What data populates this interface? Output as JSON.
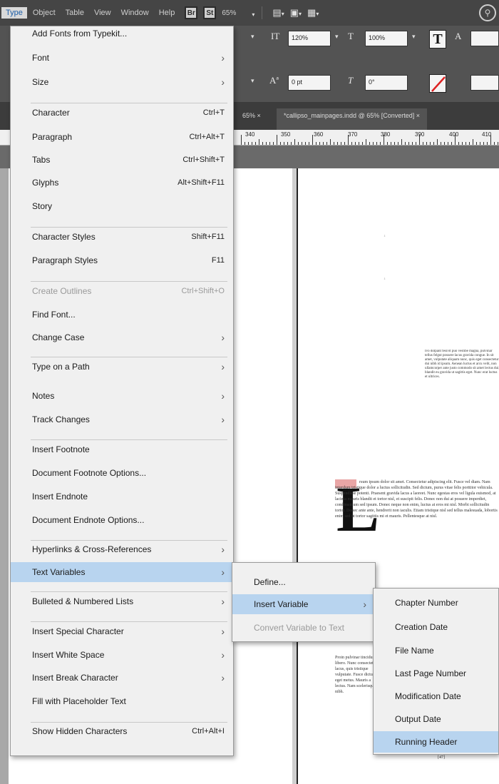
{
  "menubar": {
    "items": [
      "Type",
      "Object",
      "Table",
      "View",
      "Window",
      "Help"
    ],
    "zoom": "65%"
  },
  "control_panel": {
    "font_size_field": "120%",
    "tracking_field": "100%",
    "leading_field": "0 pt",
    "baseline_field": "0°",
    "scale_label": "A"
  },
  "tabs": {
    "inactive": "65% ×",
    "active": "*callipso_mainpages.indd @ 65% [Converted] ×"
  },
  "ruler": {
    "numbers": [
      "340",
      "350",
      "360",
      "370",
      "380",
      "390",
      "400",
      "410"
    ]
  },
  "document": {
    "sidebar_text": "Ivo dolpant fesivit puo vestibe magna, pulvinar tellus felgut posuere lacus gravida congue. In sit amet, vulputate aliquam nunc, quis eget consectetur dui nibh id ipsum. Aenean luctus et arcu velit, non ullamcorper ante justo commodo sit amet lectus dui, blandit eu gravida ut sagittis eget. Nunc erat luctus et ultrices.",
    "body_text": "rsum ipsum dolor sit amet. Consectetur adipiscing elit. Fusce vel diam. Nam interdum tristique dolor a luctus sollicitudin. Sed dictum, purus vitae felis porttitor vehicula. Suspendisse potenti. Praesent gravida lacus a laoreet. Nunc egestas eros vel ligula euismod, at lacinia mauris blandit et tortor nisl, et suscipit felis. Donec non dui at posuere imperdiet, condimentum sed ipsum. Donec neque non enim, luctus at eros mi nisl. Morbi sollicitudin tortor. Donec ante ante, hendrerit non iaculis. Etiam tristique nisl sed tellus malesuada, lobortis enim sed ut tortor sagittis mi et mauris. Pellentesque at nisl.",
    "body_text_2": "Proin pulvinar tincidunt libero. Nunc consectetur lacus, quis tristique vulputate. Fusce dictum eget metus. Mauris a lectus. Nam scelerisque nibh.",
    "dropcap": "L",
    "page_number": "[47]"
  },
  "type_menu": {
    "items": [
      {
        "label": "Add Fonts from Typekit...",
        "shortcut": "",
        "arrow": false,
        "disabled": false
      },
      {
        "label": "Font",
        "shortcut": "",
        "arrow": true,
        "disabled": false
      },
      {
        "label": "Size",
        "shortcut": "",
        "arrow": true,
        "disabled": false
      },
      {
        "label": "Character",
        "shortcut": "Ctrl+T",
        "arrow": false,
        "disabled": false
      },
      {
        "label": "Paragraph",
        "shortcut": "Ctrl+Alt+T",
        "arrow": false,
        "disabled": false
      },
      {
        "label": "Tabs",
        "shortcut": "Ctrl+Shift+T",
        "arrow": false,
        "disabled": false
      },
      {
        "label": "Glyphs",
        "shortcut": "Alt+Shift+F11",
        "arrow": false,
        "disabled": false
      },
      {
        "label": "Story",
        "shortcut": "",
        "arrow": false,
        "disabled": false
      },
      {
        "label": "Character Styles",
        "shortcut": "Shift+F11",
        "arrow": false,
        "disabled": false
      },
      {
        "label": "Paragraph Styles",
        "shortcut": "F11",
        "arrow": false,
        "disabled": false
      },
      {
        "label": "Create Outlines",
        "shortcut": "Ctrl+Shift+O",
        "arrow": false,
        "disabled": true
      },
      {
        "label": "Find Font...",
        "shortcut": "",
        "arrow": false,
        "disabled": false
      },
      {
        "label": "Change Case",
        "shortcut": "",
        "arrow": true,
        "disabled": false
      },
      {
        "label": "Type on a Path",
        "shortcut": "",
        "arrow": true,
        "disabled": false
      },
      {
        "label": "Notes",
        "shortcut": "",
        "arrow": true,
        "disabled": false
      },
      {
        "label": "Track Changes",
        "shortcut": "",
        "arrow": true,
        "disabled": false
      },
      {
        "label": "Insert Footnote",
        "shortcut": "",
        "arrow": false,
        "disabled": false
      },
      {
        "label": "Document Footnote Options...",
        "shortcut": "",
        "arrow": false,
        "disabled": false
      },
      {
        "label": "Insert Endnote",
        "shortcut": "",
        "arrow": false,
        "disabled": false
      },
      {
        "label": "Document Endnote Options...",
        "shortcut": "",
        "arrow": false,
        "disabled": false
      },
      {
        "label": "Hyperlinks & Cross-References",
        "shortcut": "",
        "arrow": true,
        "disabled": false
      },
      {
        "label": "Text Variables",
        "shortcut": "",
        "arrow": true,
        "disabled": false
      },
      {
        "label": "Bulleted & Numbered Lists",
        "shortcut": "",
        "arrow": true,
        "disabled": false
      },
      {
        "label": "Insert Special Character",
        "shortcut": "",
        "arrow": true,
        "disabled": false
      },
      {
        "label": "Insert White Space",
        "shortcut": "",
        "arrow": true,
        "disabled": false
      },
      {
        "label": "Insert Break Character",
        "shortcut": "",
        "arrow": true,
        "disabled": false
      },
      {
        "label": "Fill with Placeholder Text",
        "shortcut": "",
        "arrow": false,
        "disabled": false
      },
      {
        "label": "Show Hidden Characters",
        "shortcut": "Ctrl+Alt+I",
        "arrow": false,
        "disabled": false
      }
    ]
  },
  "text_variables_menu": {
    "items": [
      {
        "label": "Define...",
        "arrow": false,
        "disabled": false
      },
      {
        "label": "Insert Variable",
        "arrow": true,
        "disabled": false
      },
      {
        "label": "Convert Variable to Text",
        "arrow": false,
        "disabled": true
      }
    ]
  },
  "insert_variable_menu": {
    "items": [
      {
        "label": "Chapter Number"
      },
      {
        "label": "Creation Date"
      },
      {
        "label": "File Name"
      },
      {
        "label": "Last Page Number"
      },
      {
        "label": "Modification Date"
      },
      {
        "label": "Output Date"
      },
      {
        "label": "Running Header"
      }
    ]
  },
  "colors": {
    "highlight": "#b8d4ef",
    "menu_bg": "#f0f0f0",
    "menubar_bg": "#454545"
  }
}
